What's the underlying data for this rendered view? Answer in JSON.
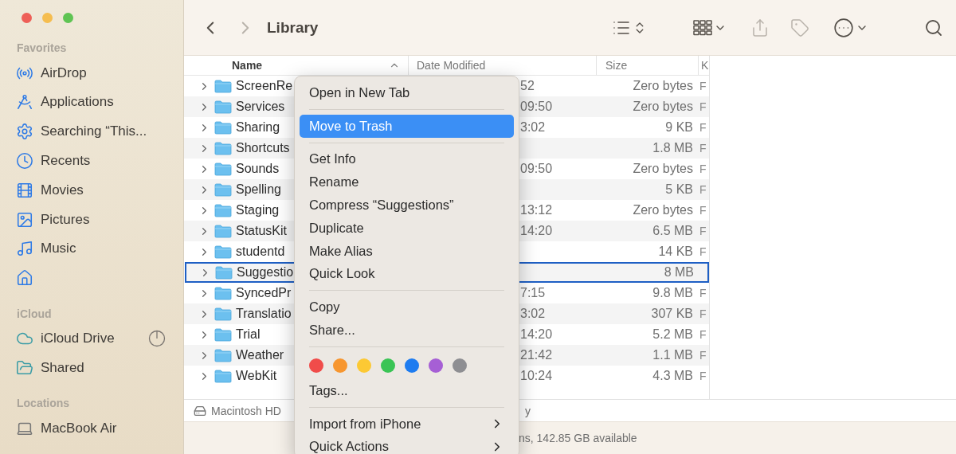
{
  "sidebar": {
    "sections": [
      {
        "title": "Favorites",
        "items": [
          {
            "kind": "airdrop",
            "label": "AirDrop"
          },
          {
            "kind": "applications",
            "label": "Applications"
          },
          {
            "kind": "search",
            "label": "Searching “This..."
          },
          {
            "kind": "recents",
            "label": "Recents"
          },
          {
            "kind": "movies",
            "label": "Movies"
          },
          {
            "kind": "pictures",
            "label": "Pictures"
          },
          {
            "kind": "music",
            "label": "Music"
          },
          {
            "kind": "home"
          }
        ]
      },
      {
        "title": "iCloud",
        "items": [
          {
            "kind": "icloud",
            "label": "iCloud Drive",
            "syncing": true
          },
          {
            "kind": "shared",
            "label": "Shared"
          }
        ]
      },
      {
        "title": "Locations",
        "items": [
          {
            "kind": "computer",
            "label": "MacBook Air"
          }
        ]
      }
    ]
  },
  "toolbar": {
    "title": "Library",
    "buttons": [
      {
        "kind": "back",
        "disabled": false
      },
      {
        "kind": "forward",
        "disabled": true
      },
      {
        "kind": "list_view",
        "disabled": false
      },
      {
        "kind": "group",
        "disabled": false
      },
      {
        "kind": "share",
        "disabled": true
      },
      {
        "kind": "tag",
        "disabled": true
      },
      {
        "kind": "more",
        "disabled": false
      },
      {
        "kind": "search",
        "disabled": false
      }
    ]
  },
  "table": {
    "columns": [
      "Name",
      "Date Modified",
      "Size",
      "K"
    ],
    "rows": [
      {
        "name": "ScreenRe",
        "date": "52",
        "size": "Zero bytes",
        "column_4": "F",
        "selected": false
      },
      {
        "name": "Services",
        "date": "09:50",
        "size": "Zero bytes",
        "column_4": "F",
        "selected": false
      },
      {
        "name": "Sharing",
        "date": "3:02",
        "size": "9 KB",
        "column_4": "F",
        "selected": false
      },
      {
        "name": "Shortcuts",
        "size": "1.8 MB",
        "column_4": "F",
        "selected": false
      },
      {
        "name": "Sounds",
        "date": "09:50",
        "size": "Zero bytes",
        "column_4": "F",
        "selected": false
      },
      {
        "name": "Spelling",
        "size": "5 KB",
        "column_4": "F",
        "selected": false
      },
      {
        "name": "Staging",
        "date": "13:12",
        "size": "Zero bytes",
        "column_4": "F",
        "selected": false
      },
      {
        "name": "StatusKit",
        "date": "14:20",
        "size": "6.5 MB",
        "column_4": "F",
        "selected": false
      },
      {
        "name": "studentd",
        "size": "14 KB",
        "column_4": "F",
        "selected": false
      },
      {
        "name": "Suggestio",
        "size": "8 MB",
        "selected": true
      },
      {
        "name": "SyncedPr",
        "date": "7:15",
        "size": "9.8 MB",
        "column_4": "F",
        "selected": false
      },
      {
        "name": "Translatio",
        "date": "3:02",
        "size": "307 KB",
        "column_4": "F",
        "selected": false
      },
      {
        "name": "Trial",
        "date": "14:20",
        "size": "5.2 MB",
        "column_4": "F",
        "selected": false
      },
      {
        "name": "Weather",
        "date": "21:42",
        "size": "1.1 MB",
        "column_4": "F",
        "selected": false
      },
      {
        "name": "WebKit",
        "date": "10:24",
        "size": "4.3 MB",
        "column_4": "F",
        "selected": false
      }
    ]
  },
  "path_bar": {
    "volume": "Macintosh HD",
    "folder": "y"
  },
  "status_bar": "ns, 142.85 GB available",
  "context_menu": [
    {
      "kind": "item",
      "label": "Open in New Tab",
      "selected": false
    },
    {
      "kind": "separator"
    },
    {
      "kind": "item",
      "label": "Move to Trash",
      "selected": true
    },
    {
      "kind": "separator"
    },
    {
      "kind": "item",
      "label": "Get Info",
      "selected": false
    },
    {
      "kind": "item",
      "label": "Rename",
      "selected": false
    },
    {
      "kind": "item",
      "label": "Compress “Suggestions”",
      "selected": false
    },
    {
      "kind": "item",
      "label": "Duplicate",
      "selected": false
    },
    {
      "kind": "item",
      "label": "Make Alias",
      "selected": false
    },
    {
      "kind": "item",
      "label": "Quick Look",
      "selected": false
    },
    {
      "kind": "separator"
    },
    {
      "kind": "item",
      "label": "Copy",
      "selected": false
    },
    {
      "kind": "item",
      "label": "Share...",
      "selected": false
    },
    {
      "kind": "separator"
    },
    {
      "kind": "tags",
      "colors": [
        {
          "color": "#f04c4a"
        },
        {
          "color": "#f7962f"
        },
        {
          "color": "#fcc934"
        },
        {
          "color": "#3ac455"
        },
        {
          "color": "#1e7cf0"
        },
        {
          "color": "#a65fd5"
        },
        {
          "color": "#8e8e92"
        }
      ]
    },
    {
      "kind": "item",
      "label": "Tags...",
      "selected": false
    },
    {
      "kind": "separator"
    },
    {
      "kind": "submenu",
      "label": "Import from iPhone",
      "selected": false
    },
    {
      "kind": "submenu",
      "label": "Quick Actions",
      "selected": false
    }
  ]
}
